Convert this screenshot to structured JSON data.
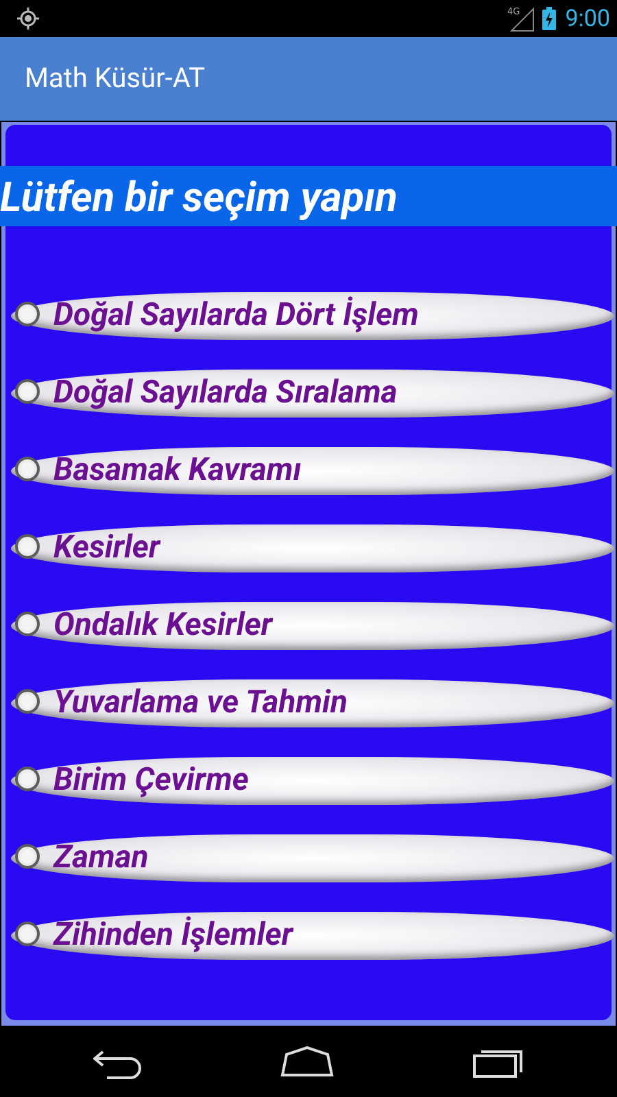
{
  "status_bar": {
    "left_icon": "gps-icon",
    "network": "4G",
    "signal_icon": "signal-icon",
    "battery_icon": "battery-charging-icon",
    "time": "9:00"
  },
  "action_bar": {
    "title": "Math Küsür-AT"
  },
  "main": {
    "prompt": "Lütfen bir seçim yapın",
    "options": [
      {
        "label": "Doğal Sayılarda Dört İşlem",
        "selected": false
      },
      {
        "label": "Doğal Sayılarda Sıralama",
        "selected": false
      },
      {
        "label": "Basamak Kavramı",
        "selected": false
      },
      {
        "label": "Kesirler",
        "selected": false
      },
      {
        "label": "Ondalık Kesirler",
        "selected": false
      },
      {
        "label": "Yuvarlama ve Tahmin",
        "selected": false
      },
      {
        "label": "Birim Çevirme",
        "selected": false
      },
      {
        "label": "Zaman",
        "selected": false
      },
      {
        "label": "Zihinden İşlemler",
        "selected": false
      }
    ]
  },
  "nav_bar": {
    "back_icon": "back-icon",
    "home_icon": "home-icon",
    "recents_icon": "recent-apps-icon"
  },
  "colors": {
    "action_bar": "#4a80d0",
    "panel": "#2a0af2",
    "prompt_band": "#0a66e8",
    "option_text": "#6a1090",
    "status_accent": "#33b5e5"
  }
}
